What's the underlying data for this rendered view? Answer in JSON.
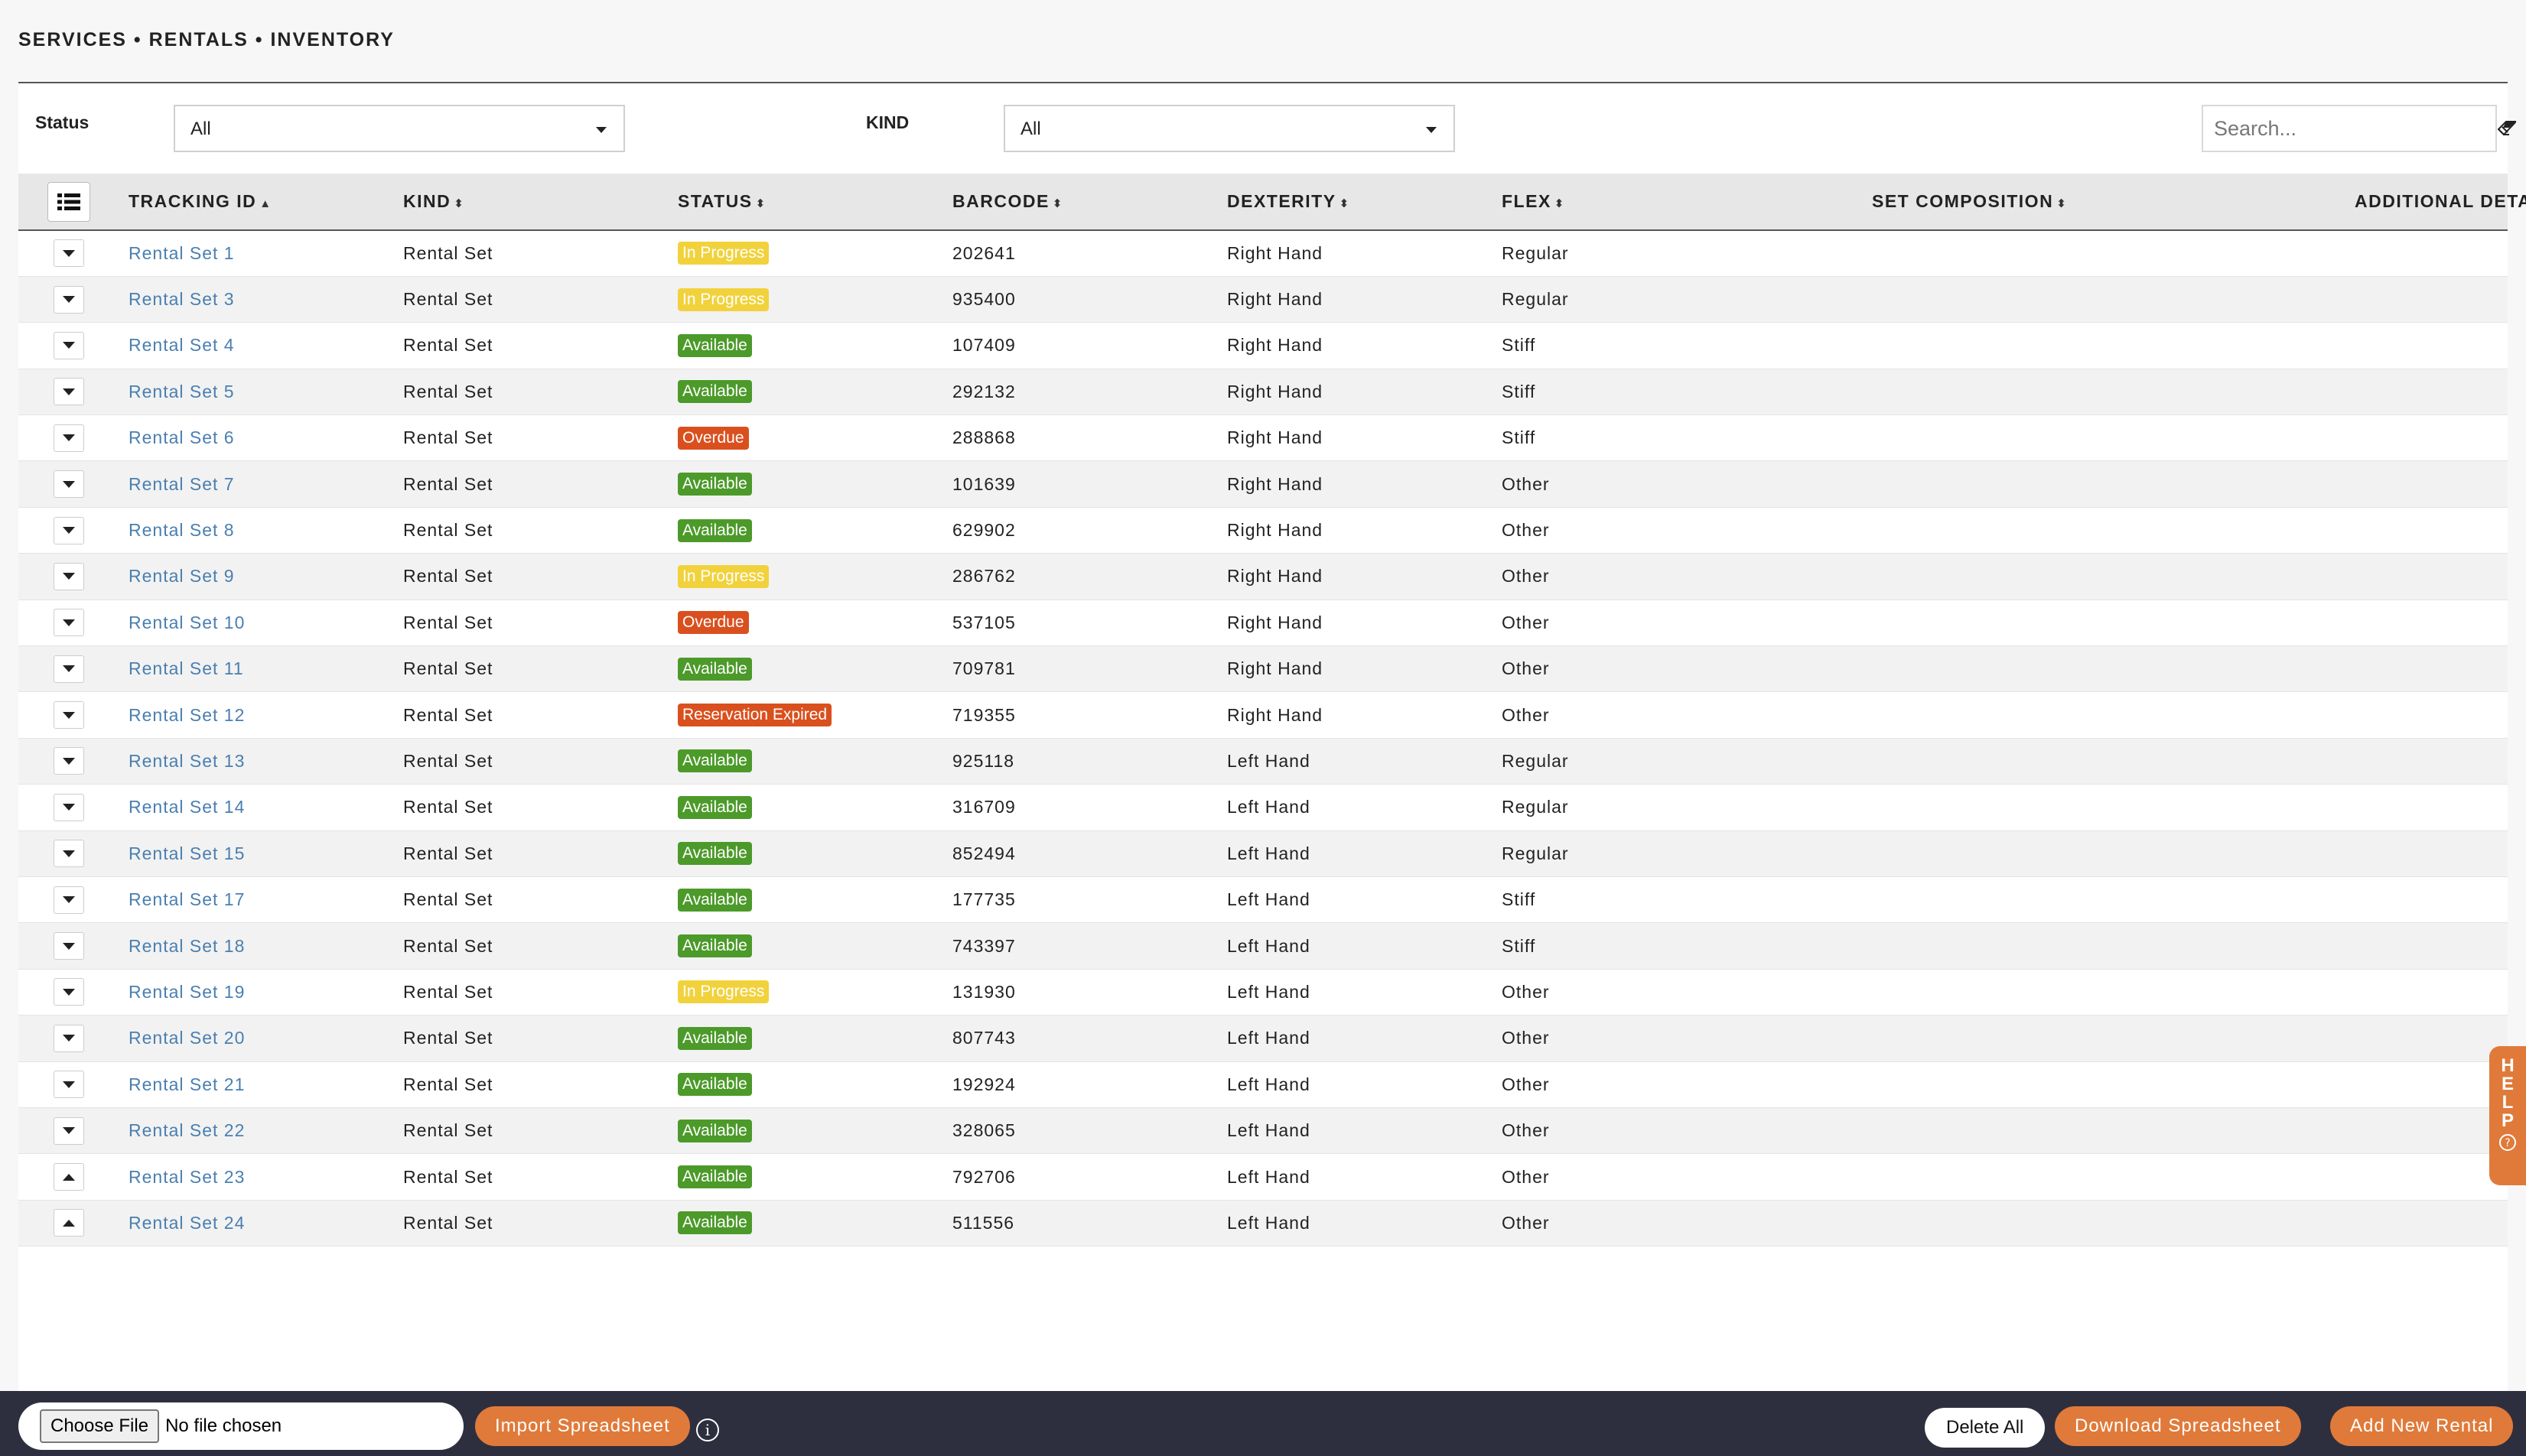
{
  "breadcrumb": "SERVICES • RENTALS • INVENTORY",
  "filters": {
    "status_label": "Status",
    "status_value": "All",
    "kind_label": "KIND",
    "kind_value": "All",
    "search_placeholder": "Search..."
  },
  "table": {
    "headers": {
      "tracking_id": "TRACKING ID",
      "kind": "KIND",
      "status": "STATUS",
      "barcode": "BARCODE",
      "dexterity": "DEXTERITY",
      "flex": "FLEX",
      "set_composition": "SET COMPOSITION",
      "additional_details": "ADDITIONAL DETAILS"
    },
    "rows": [
      {
        "id": "Rental Set 1",
        "kind": "Rental Set",
        "status": "In Progress",
        "status_type": "progress",
        "barcode": "202641",
        "dexterity": "Right Hand",
        "flex": "Regular",
        "expanded": false
      },
      {
        "id": "Rental Set 3",
        "kind": "Rental Set",
        "status": "In Progress",
        "status_type": "progress",
        "barcode": "935400",
        "dexterity": "Right Hand",
        "flex": "Regular",
        "expanded": false
      },
      {
        "id": "Rental Set 4",
        "kind": "Rental Set",
        "status": "Available",
        "status_type": "available",
        "barcode": "107409",
        "dexterity": "Right Hand",
        "flex": "Stiff",
        "expanded": false
      },
      {
        "id": "Rental Set 5",
        "kind": "Rental Set",
        "status": "Available",
        "status_type": "available",
        "barcode": "292132",
        "dexterity": "Right Hand",
        "flex": "Stiff",
        "expanded": false
      },
      {
        "id": "Rental Set 6",
        "kind": "Rental Set",
        "status": "Overdue",
        "status_type": "overdue",
        "barcode": "288868",
        "dexterity": "Right Hand",
        "flex": "Stiff",
        "expanded": false
      },
      {
        "id": "Rental Set 7",
        "kind": "Rental Set",
        "status": "Available",
        "status_type": "available",
        "barcode": "101639",
        "dexterity": "Right Hand",
        "flex": "Other",
        "expanded": false
      },
      {
        "id": "Rental Set 8",
        "kind": "Rental Set",
        "status": "Available",
        "status_type": "available",
        "barcode": "629902",
        "dexterity": "Right Hand",
        "flex": "Other",
        "expanded": false
      },
      {
        "id": "Rental Set 9",
        "kind": "Rental Set",
        "status": "In Progress",
        "status_type": "progress",
        "barcode": "286762",
        "dexterity": "Right Hand",
        "flex": "Other",
        "expanded": false
      },
      {
        "id": "Rental Set 10",
        "kind": "Rental Set",
        "status": "Overdue",
        "status_type": "overdue",
        "barcode": "537105",
        "dexterity": "Right Hand",
        "flex": "Other",
        "expanded": false
      },
      {
        "id": "Rental Set 11",
        "kind": "Rental Set",
        "status": "Available",
        "status_type": "available",
        "barcode": "709781",
        "dexterity": "Right Hand",
        "flex": "Other",
        "expanded": false
      },
      {
        "id": "Rental Set 12",
        "kind": "Rental Set",
        "status": "Reservation Expired",
        "status_type": "expired",
        "barcode": "719355",
        "dexterity": "Right Hand",
        "flex": "Other",
        "expanded": false
      },
      {
        "id": "Rental Set 13",
        "kind": "Rental Set",
        "status": "Available",
        "status_type": "available",
        "barcode": "925118",
        "dexterity": "Left Hand",
        "flex": "Regular",
        "expanded": false
      },
      {
        "id": "Rental Set 14",
        "kind": "Rental Set",
        "status": "Available",
        "status_type": "available",
        "barcode": "316709",
        "dexterity": "Left Hand",
        "flex": "Regular",
        "expanded": false
      },
      {
        "id": "Rental Set 15",
        "kind": "Rental Set",
        "status": "Available",
        "status_type": "available",
        "barcode": "852494",
        "dexterity": "Left Hand",
        "flex": "Regular",
        "expanded": false
      },
      {
        "id": "Rental Set 17",
        "kind": "Rental Set",
        "status": "Available",
        "status_type": "available",
        "barcode": "177735",
        "dexterity": "Left Hand",
        "flex": "Stiff",
        "expanded": false
      },
      {
        "id": "Rental Set 18",
        "kind": "Rental Set",
        "status": "Available",
        "status_type": "available",
        "barcode": "743397",
        "dexterity": "Left Hand",
        "flex": "Stiff",
        "expanded": false
      },
      {
        "id": "Rental Set 19",
        "kind": "Rental Set",
        "status": "In Progress",
        "status_type": "progress",
        "barcode": "131930",
        "dexterity": "Left Hand",
        "flex": "Other",
        "expanded": false
      },
      {
        "id": "Rental Set 20",
        "kind": "Rental Set",
        "status": "Available",
        "status_type": "available",
        "barcode": "807743",
        "dexterity": "Left Hand",
        "flex": "Other",
        "expanded": false
      },
      {
        "id": "Rental Set 21",
        "kind": "Rental Set",
        "status": "Available",
        "status_type": "available",
        "barcode": "192924",
        "dexterity": "Left Hand",
        "flex": "Other",
        "expanded": false
      },
      {
        "id": "Rental Set 22",
        "kind": "Rental Set",
        "status": "Available",
        "status_type": "available",
        "barcode": "328065",
        "dexterity": "Left Hand",
        "flex": "Other",
        "expanded": false
      },
      {
        "id": "Rental Set 23",
        "kind": "Rental Set",
        "status": "Available",
        "status_type": "available",
        "barcode": "792706",
        "dexterity": "Left Hand",
        "flex": "Other",
        "expanded": true
      },
      {
        "id": "Rental Set 24",
        "kind": "Rental Set",
        "status": "Available",
        "status_type": "available",
        "barcode": "511556",
        "dexterity": "Left Hand",
        "flex": "Other",
        "expanded": true
      }
    ]
  },
  "help_tab": {
    "letters": [
      "H",
      "E",
      "L",
      "P"
    ],
    "icon": "question-circle-icon"
  },
  "footer": {
    "choose_file_label": "Choose File",
    "no_file_label": "No file chosen",
    "import_label": "Import Spreadsheet",
    "delete_all_label": "Delete All",
    "download_label": "Download Spreadsheet",
    "add_new_label": "Add New Rental"
  },
  "colors": {
    "accent": "#e07a3a",
    "link": "#4a7fb0",
    "in_progress": "#f1d23c",
    "available": "#4c9a2a",
    "overdue": "#d9501e",
    "footer_bg": "#2e2f3e"
  }
}
